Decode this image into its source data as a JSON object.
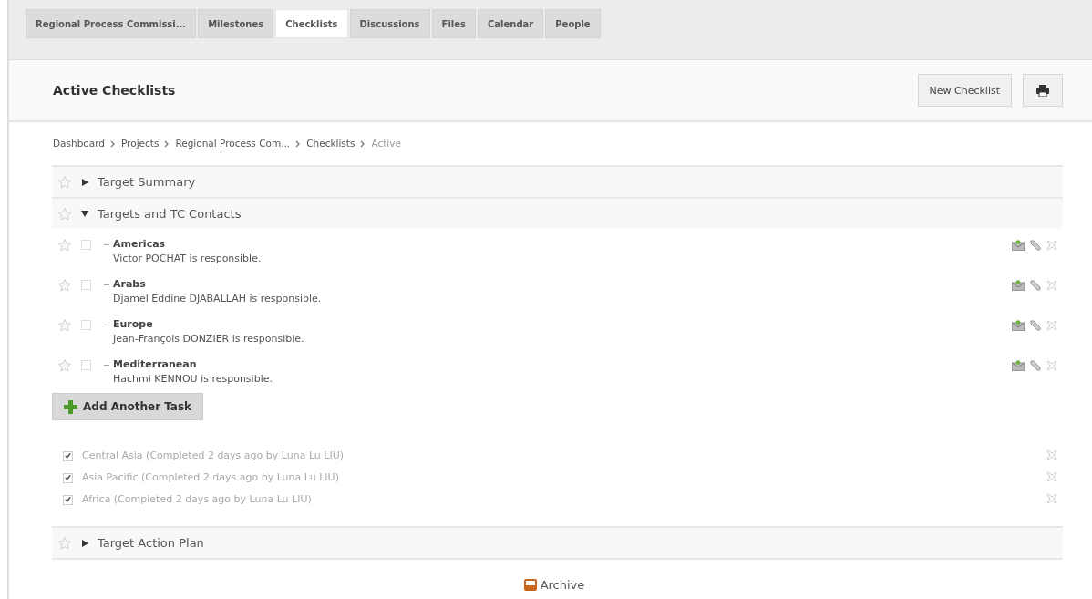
{
  "tabs": [
    {
      "label": "Regional Process Commissi...",
      "selected": false
    },
    {
      "label": "Milestones",
      "selected": false
    },
    {
      "label": "Checklists",
      "selected": true
    },
    {
      "label": "Discussions",
      "selected": false
    },
    {
      "label": "Files",
      "selected": false
    },
    {
      "label": "Calendar",
      "selected": false
    },
    {
      "label": "People",
      "selected": false
    }
  ],
  "header": {
    "title": "Active Checklists",
    "new_button": "New Checklist"
  },
  "breadcrumb": [
    {
      "label": "Dashboard",
      "kind": "link"
    },
    {
      "label": "Projects",
      "kind": "link"
    },
    {
      "label": "Regional Process Com...",
      "kind": "link"
    },
    {
      "label": "Checklists",
      "kind": "link"
    },
    {
      "label": "Active",
      "kind": "current"
    }
  ],
  "sections": [
    {
      "title": "Target Summary",
      "expanded": false
    },
    {
      "title": "Targets and TC Contacts",
      "expanded": true,
      "tasks": [
        {
          "name": "Americas",
          "responsible": "Victor POCHAT is responsible.",
          "checked": false
        },
        {
          "name": "Arabs",
          "responsible": "Djamel Eddine DJABALLAH is responsible.",
          "checked": false
        },
        {
          "name": "Europe",
          "responsible": "Jean-François DONZIER is responsible.",
          "checked": false
        },
        {
          "name": "Mediterranean",
          "responsible": "Hachmi KENNOU is responsible.",
          "checked": false
        }
      ],
      "add_button": "Add Another Task",
      "completed": [
        {
          "text": "Central Asia (Completed 2 days ago by Luna Lu LIU)",
          "checked": true
        },
        {
          "text": "Asia Pacific (Completed 2 days ago by Luna Lu LIU)",
          "checked": true
        },
        {
          "text": "Africa (Completed 2 days ago by Luna Lu LIU)",
          "checked": true
        }
      ]
    },
    {
      "title": "Target Action Plan",
      "expanded": false
    }
  ],
  "archive": "Archive"
}
